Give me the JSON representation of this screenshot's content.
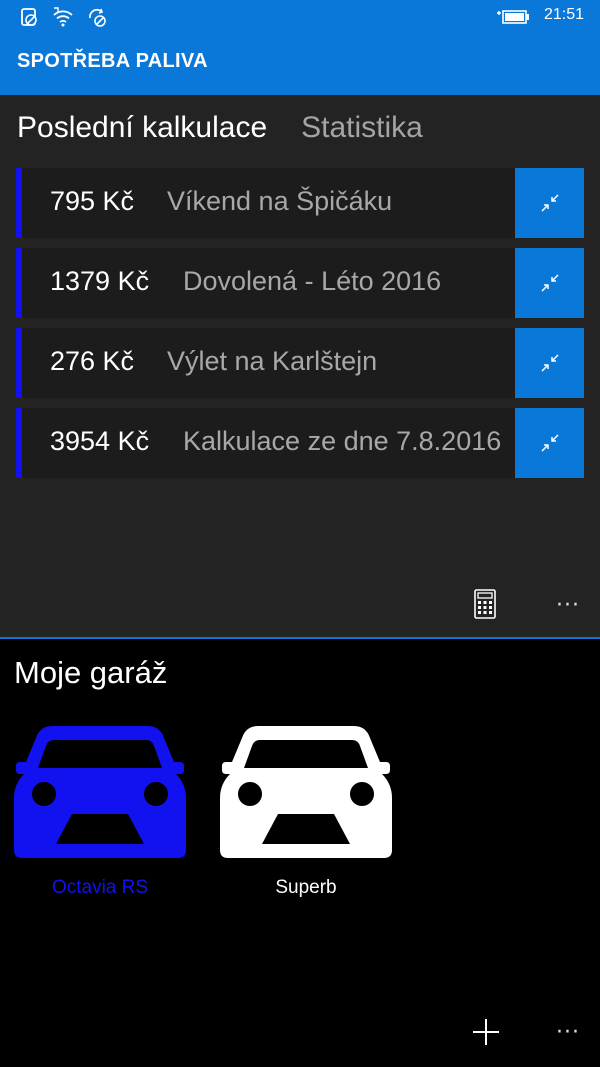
{
  "status": {
    "time": "21:51",
    "icons": [
      "sim-off-icon",
      "wifi-icon",
      "sync-off-icon",
      "battery-charging-icon"
    ]
  },
  "app": {
    "title": "SPOTŘEBA PALIVA"
  },
  "pivot": {
    "tabs": [
      {
        "label": "Poslední kalkulace",
        "active": true
      },
      {
        "label": "Statistika",
        "active": false
      }
    ]
  },
  "calculations": [
    {
      "price": "795 Kč",
      "name": "Víkend na Špičáku"
    },
    {
      "price": "1379 Kč",
      "name": "Dovolená - Léto 2016"
    },
    {
      "price": "276 Kč",
      "name": "Výlet na Karlštejn"
    },
    {
      "price": "3954 Kč",
      "name": "Kalkulace ze dne 7.8.2016"
    }
  ],
  "top_commands": {
    "calculator_icon": "calculator-icon",
    "more_label": "···"
  },
  "garage": {
    "title": "Moje garáž",
    "cars": [
      {
        "label": "Octavia RS",
        "color": "#1212f0"
      },
      {
        "label": "Superb",
        "color": "#ffffff"
      }
    ]
  },
  "bottom_commands": {
    "add_icon": "plus-icon",
    "more_label": "···"
  },
  "colors": {
    "accent": "#0a78d8",
    "selected": "#1212f0",
    "panel": "#232323",
    "row": "#1c1c1c"
  }
}
